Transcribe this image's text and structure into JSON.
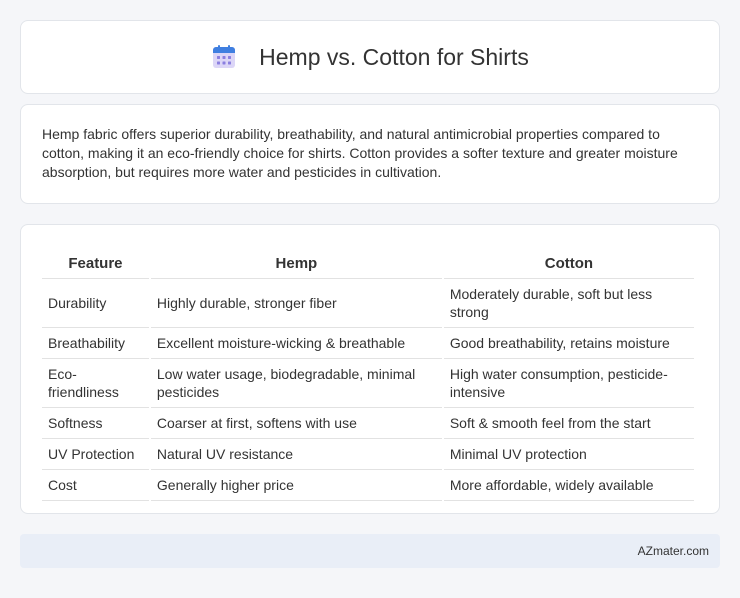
{
  "header": {
    "title": "Hemp vs. Cotton for Shirts",
    "icon": "calendar-icon",
    "icon_colors": {
      "top": "#3f7fe0",
      "body": "#dcd6f7",
      "dots": "#8b7fe0"
    }
  },
  "description": "Hemp fabric offers superior durability, breathability, and natural antimicrobial properties compared to cotton, making it an eco-friendly choice for shirts. Cotton provides a softer texture and greater moisture absorption, but requires more water and pesticides in cultivation.",
  "table": {
    "headers": [
      "Feature",
      "Hemp",
      "Cotton"
    ],
    "rows": [
      [
        "Durability",
        "Highly durable, stronger fiber",
        "Moderately durable, soft but less strong"
      ],
      [
        "Breathability",
        "Excellent moisture-wicking & breathable",
        "Good breathability, retains moisture"
      ],
      [
        "Eco-friendliness",
        "Low water usage, biodegradable, minimal pesticides",
        "High water consumption, pesticide-intensive"
      ],
      [
        "Softness",
        "Coarser at first, softens with use",
        "Soft & smooth feel from the start"
      ],
      [
        "UV Protection",
        "Natural UV resistance",
        "Minimal UV protection"
      ],
      [
        "Cost",
        "Generally higher price",
        "More affordable, widely available"
      ]
    ]
  },
  "footer": {
    "text": "AZmater.com"
  },
  "colors": {
    "background": "#f5f6f9",
    "card": "#ffffff",
    "footer_bg": "#e9eef7",
    "text": "#333333"
  }
}
